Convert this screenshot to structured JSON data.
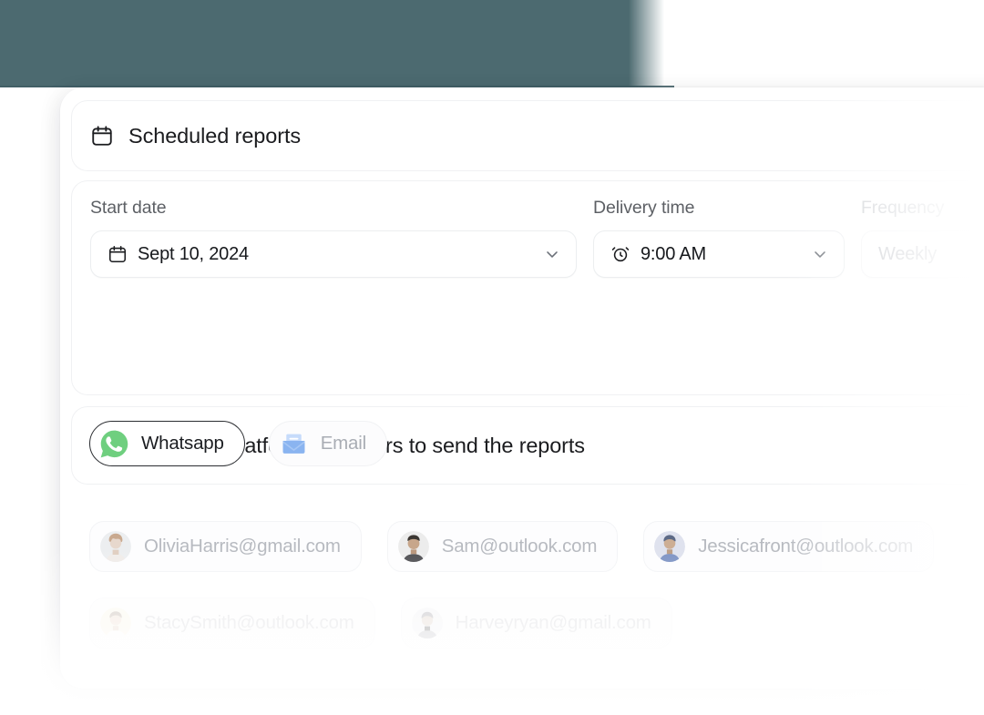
{
  "theme": {
    "backdrop_color": "#4c6a70",
    "page_background": "#ffffff",
    "text_primary": "#1b1c1f",
    "text_muted": "#5d6065",
    "text_faded": "#b7bac0",
    "border_color": "#f0f1f3",
    "whatsapp_green": "#6fcf7f",
    "email_blue": "#8ab4f0"
  },
  "header": {
    "icon": "calendar-icon",
    "title": "Scheduled reports"
  },
  "schedule": {
    "fields": [
      {
        "label": "Start date",
        "value": "Sept 10, 2024",
        "icon": "calendar-icon",
        "chevron": "chevron-down-icon",
        "faded": false
      },
      {
        "label": "Delivery time",
        "value": "9:00 AM",
        "icon": "alarm-clock-icon",
        "chevron": "chevron-down-icon",
        "faded": false
      },
      {
        "label": "Frequency",
        "value": "Weekly",
        "icon": "",
        "chevron": "",
        "faded": true
      }
    ]
  },
  "platform_section": {
    "icon": "box-3d-icon",
    "title": "Select the platform and users to send the reports",
    "platforms": [
      {
        "label": "Whatsapp",
        "icon": "whatsapp-icon",
        "selected": true
      },
      {
        "label": "Email",
        "icon": "email-envelope-icon",
        "selected": false
      }
    ]
  },
  "recipients": {
    "rows": [
      [
        {
          "email": "OliviaHarris@gmail.com",
          "avatar": "avatar-olivia"
        },
        {
          "email": "Sam@outlook.com",
          "avatar": "avatar-sam"
        },
        {
          "email": "Jessicafront@outlook.com",
          "avatar": "avatar-jessica"
        }
      ],
      [
        {
          "email": "StacySmith@outlook.com",
          "avatar": "avatar-stacy"
        },
        {
          "email": "Harveyryan@gmail.com",
          "avatar": "avatar-harvey"
        }
      ]
    ]
  }
}
